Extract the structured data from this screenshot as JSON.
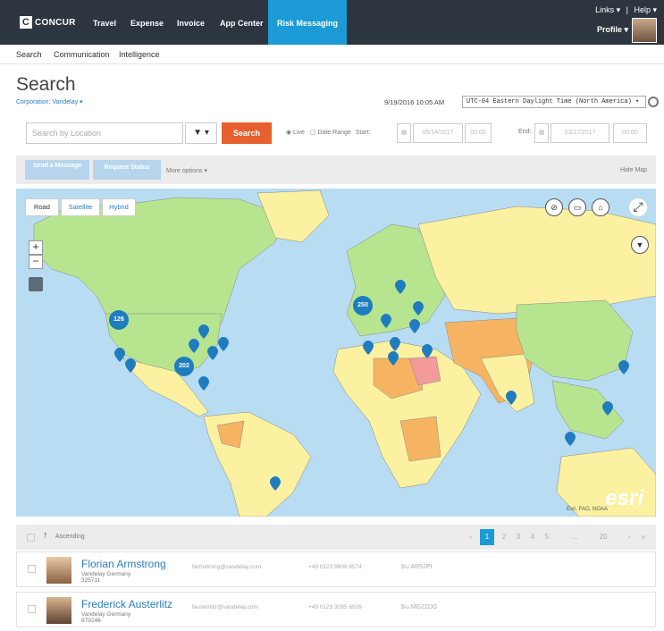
{
  "topnav": {
    "logo": "CONCUR",
    "items": [
      "Travel",
      "Expense",
      "Invoice",
      "App Center",
      "Risk Messaging"
    ],
    "links": "Links ▾",
    "help": "Help ▾",
    "profile": "Profile ▾"
  },
  "subnav": {
    "items": [
      "Search",
      "Communication",
      "Intelligence"
    ]
  },
  "header": {
    "title": "Search",
    "corporation": "Corporation: Vandelay ▾",
    "datetime": "9/19/2016 10:05 AM",
    "timezone": "UTC-04   Eastern Daylight Time (North America)  ▾"
  },
  "search": {
    "placeholder": "Search by Location",
    "filter": "▼ ▾",
    "button": "Search",
    "live": "◉ Live",
    "date_range": "▢ Date Range",
    "start_label": "Start:",
    "start_date": "05/14/2017",
    "start_time": "00:00",
    "end_label": "End:",
    "end_date": "03/17/2017",
    "end_time": "00:00"
  },
  "options": {
    "send_message": "Send a Message",
    "request_status": "Request Status",
    "more_options": "More options ▾",
    "hide_map": "Hide Map"
  },
  "map": {
    "tabs": [
      "Road",
      "Satellite",
      "Hybrid"
    ],
    "zoom_in": "+",
    "zoom_out": "−",
    "clusters": [
      "126",
      "250",
      "202"
    ],
    "attribution": "Esri, FAO, NOAA",
    "logo": "esri"
  },
  "results": {
    "sort_label": "Ascending",
    "pages": [
      "‹",
      "1",
      "2",
      "3",
      "4",
      "5",
      "…",
      "20",
      "›",
      "»"
    ],
    "rows": [
      {
        "name": "Florian Armstrong",
        "company": "Vandelay Germany",
        "id": "325711",
        "email": "farmstrong@vandelay.com",
        "phone": "+49 0123 9608 8574",
        "flight": "AR52PI"
      },
      {
        "name": "Frederick Austerlitz",
        "company": "Vandelay Germany",
        "id": "879246",
        "email": "fausterlitz@vandelay.com",
        "phone": "+49 0123 3285 6929",
        "flight": "MG22DG"
      }
    ]
  },
  "colors": {
    "nav_bg": "#2d3540",
    "accent": "#1b9ad6",
    "search_btn": "#e6612f",
    "ocean": "#b8dcf1",
    "pin": "#1f7cbf"
  }
}
